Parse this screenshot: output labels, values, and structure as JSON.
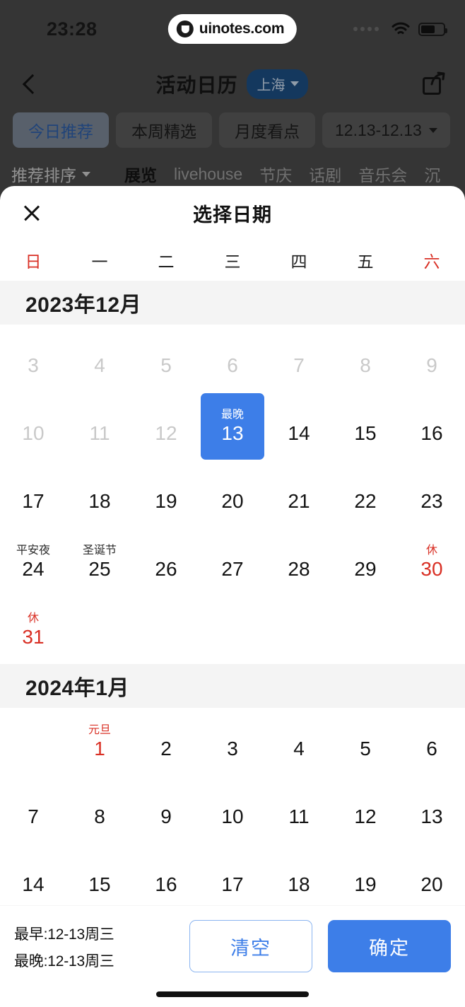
{
  "status_bar": {
    "time": "23:28",
    "wifi_icon": "wifi-icon",
    "battery_icon": "battery-icon",
    "signal_icon": "signal-dots-icon"
  },
  "watermark": {
    "text": "uinotes.com",
    "logo_icon": "uinotes-logo-icon"
  },
  "background_app": {
    "back_icon": "back-chevron-icon",
    "title": "活动日历",
    "city": "上海",
    "city_caret_icon": "chevron-down-icon",
    "share_icon": "share-icon",
    "chips": [
      {
        "label": "今日推荐",
        "active": true
      },
      {
        "label": "本周精选",
        "active": false
      },
      {
        "label": "月度看点",
        "active": false
      },
      {
        "label": "12.13-12.13",
        "active": false,
        "caret": true
      }
    ],
    "categories": [
      {
        "label": "推荐排序",
        "caret": true,
        "active": false
      },
      {
        "label": "展览",
        "active": true
      },
      {
        "label": "livehouse",
        "active": false
      },
      {
        "label": "节庆",
        "active": false
      },
      {
        "label": "话剧",
        "active": false
      },
      {
        "label": "音乐会",
        "active": false
      },
      {
        "label": "沉",
        "active": false
      }
    ]
  },
  "sheet": {
    "close_icon": "close-icon",
    "title": "选择日期",
    "weekdays": [
      {
        "label": "日",
        "weekend": true
      },
      {
        "label": "一",
        "weekend": false
      },
      {
        "label": "二",
        "weekend": false
      },
      {
        "label": "三",
        "weekend": false
      },
      {
        "label": "四",
        "weekend": false
      },
      {
        "label": "五",
        "weekend": false
      },
      {
        "label": "六",
        "weekend": true
      }
    ],
    "months": [
      {
        "heading": "2023年12月",
        "leading_blanks": 0,
        "days": [
          {
            "num": "3",
            "label": "",
            "state": "dim"
          },
          {
            "num": "4",
            "label": "",
            "state": "dim"
          },
          {
            "num": "5",
            "label": "",
            "state": "dim"
          },
          {
            "num": "6",
            "label": "",
            "state": "dim"
          },
          {
            "num": "7",
            "label": "",
            "state": "dim"
          },
          {
            "num": "8",
            "label": "",
            "state": "dim"
          },
          {
            "num": "9",
            "label": "",
            "state": "dim"
          },
          {
            "num": "10",
            "label": "",
            "state": "dim"
          },
          {
            "num": "11",
            "label": "",
            "state": "dim"
          },
          {
            "num": "12",
            "label": "",
            "state": "dim"
          },
          {
            "num": "13",
            "label": "最晚",
            "state": "selected"
          },
          {
            "num": "14",
            "label": "",
            "state": "normal"
          },
          {
            "num": "15",
            "label": "",
            "state": "normal"
          },
          {
            "num": "16",
            "label": "",
            "state": "normal"
          },
          {
            "num": "17",
            "label": "",
            "state": "normal"
          },
          {
            "num": "18",
            "label": "",
            "state": "normal"
          },
          {
            "num": "19",
            "label": "",
            "state": "normal"
          },
          {
            "num": "20",
            "label": "",
            "state": "normal"
          },
          {
            "num": "21",
            "label": "",
            "state": "normal"
          },
          {
            "num": "22",
            "label": "",
            "state": "normal"
          },
          {
            "num": "23",
            "label": "",
            "state": "normal"
          },
          {
            "num": "24",
            "label": "平安夜",
            "state": "normal"
          },
          {
            "num": "25",
            "label": "圣诞节",
            "state": "normal"
          },
          {
            "num": "26",
            "label": "",
            "state": "normal"
          },
          {
            "num": "27",
            "label": "",
            "state": "normal"
          },
          {
            "num": "28",
            "label": "",
            "state": "normal"
          },
          {
            "num": "29",
            "label": "",
            "state": "normal"
          },
          {
            "num": "30",
            "label": "休",
            "state": "rest"
          },
          {
            "num": "31",
            "label": "休",
            "state": "rest"
          }
        ]
      },
      {
        "heading": "2024年1月",
        "leading_blanks": 1,
        "days": [
          {
            "num": "1",
            "label": "元旦",
            "state": "rest"
          },
          {
            "num": "2",
            "label": "",
            "state": "normal"
          },
          {
            "num": "3",
            "label": "",
            "state": "normal"
          },
          {
            "num": "4",
            "label": "",
            "state": "normal"
          },
          {
            "num": "5",
            "label": "",
            "state": "normal"
          },
          {
            "num": "6",
            "label": "",
            "state": "normal"
          },
          {
            "num": "7",
            "label": "",
            "state": "normal"
          },
          {
            "num": "8",
            "label": "",
            "state": "normal"
          },
          {
            "num": "9",
            "label": "",
            "state": "normal"
          },
          {
            "num": "10",
            "label": "",
            "state": "normal"
          },
          {
            "num": "11",
            "label": "",
            "state": "normal"
          },
          {
            "num": "12",
            "label": "",
            "state": "normal"
          },
          {
            "num": "13",
            "label": "",
            "state": "normal"
          },
          {
            "num": "14",
            "label": "",
            "state": "normal"
          },
          {
            "num": "15",
            "label": "",
            "state": "normal"
          },
          {
            "num": "16",
            "label": "",
            "state": "normal"
          },
          {
            "num": "17",
            "label": "",
            "state": "normal"
          },
          {
            "num": "18",
            "label": "",
            "state": "normal"
          },
          {
            "num": "19",
            "label": "",
            "state": "normal"
          },
          {
            "num": "20",
            "label": "",
            "state": "normal"
          }
        ]
      }
    ],
    "footer": {
      "earliest": "最早:12-13周三",
      "latest": "最晚:12-13周三",
      "clear_label": "清空",
      "confirm_label": "确定"
    }
  },
  "colors": {
    "accent_blue": "#3d7ee8",
    "holiday_red": "#d93025",
    "dim_grey": "#c9c9c9",
    "month_band": "#f4f4f4"
  }
}
